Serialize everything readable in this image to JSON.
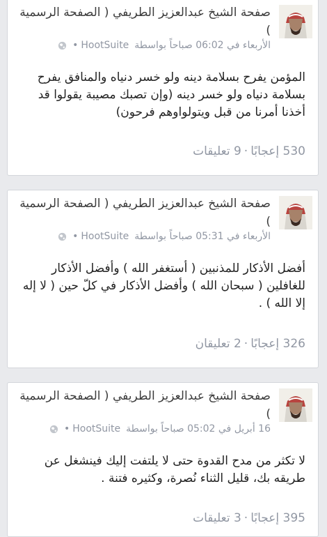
{
  "posts": [
    {
      "page_name": "صفحة الشيخ عبدالعزيز الطريفي ( الصفحة الرسمية )",
      "day": "الأربعاء في 06:02 صباحاً بواسطة",
      "via": "HootSuite",
      "text": "المؤمن يفرح بسلامة دينه ولو خسر دنياه والمنافق يفرح بسلامة دنياه ولو خسر دينه (وإن تصبك مصيبة يقولوا قد أخذنا أمرنا من قبل ويتولواوهم فرحون)",
      "likes": "530 إعجابًا",
      "comments": "9 تعليقات"
    },
    {
      "page_name": "صفحة الشيخ عبدالعزيز الطريفي ( الصفحة الرسمية )",
      "day": "الأربعاء في 05:31 صباحاً بواسطة",
      "via": "HootSuite",
      "text": "أفضل الأذكار للمذنبين ( أستغفر الله ) وأفضل الأذكار للغافلين ( سبحان الله ) وأفضل الأذكار في كلّ حين ( لا إله إلا الله ) .",
      "likes": "326 إعجابًا",
      "comments": "2 تعليقان"
    },
    {
      "page_name": "صفحة الشيخ عبدالعزيز الطريفي ( الصفحة الرسمية )",
      "day": "16 أبريل في 05:02 صباحاً بواسطة",
      "via": "HootSuite",
      "text": "لا تكثر من مدح القدوة حتى لا يلتفت إليك فينشغل عن طريقه بك، قليل الثناء نُصرة، وكثيره فتنة .",
      "likes": "395 إعجابًا",
      "comments": "3 تعليقات"
    }
  ]
}
